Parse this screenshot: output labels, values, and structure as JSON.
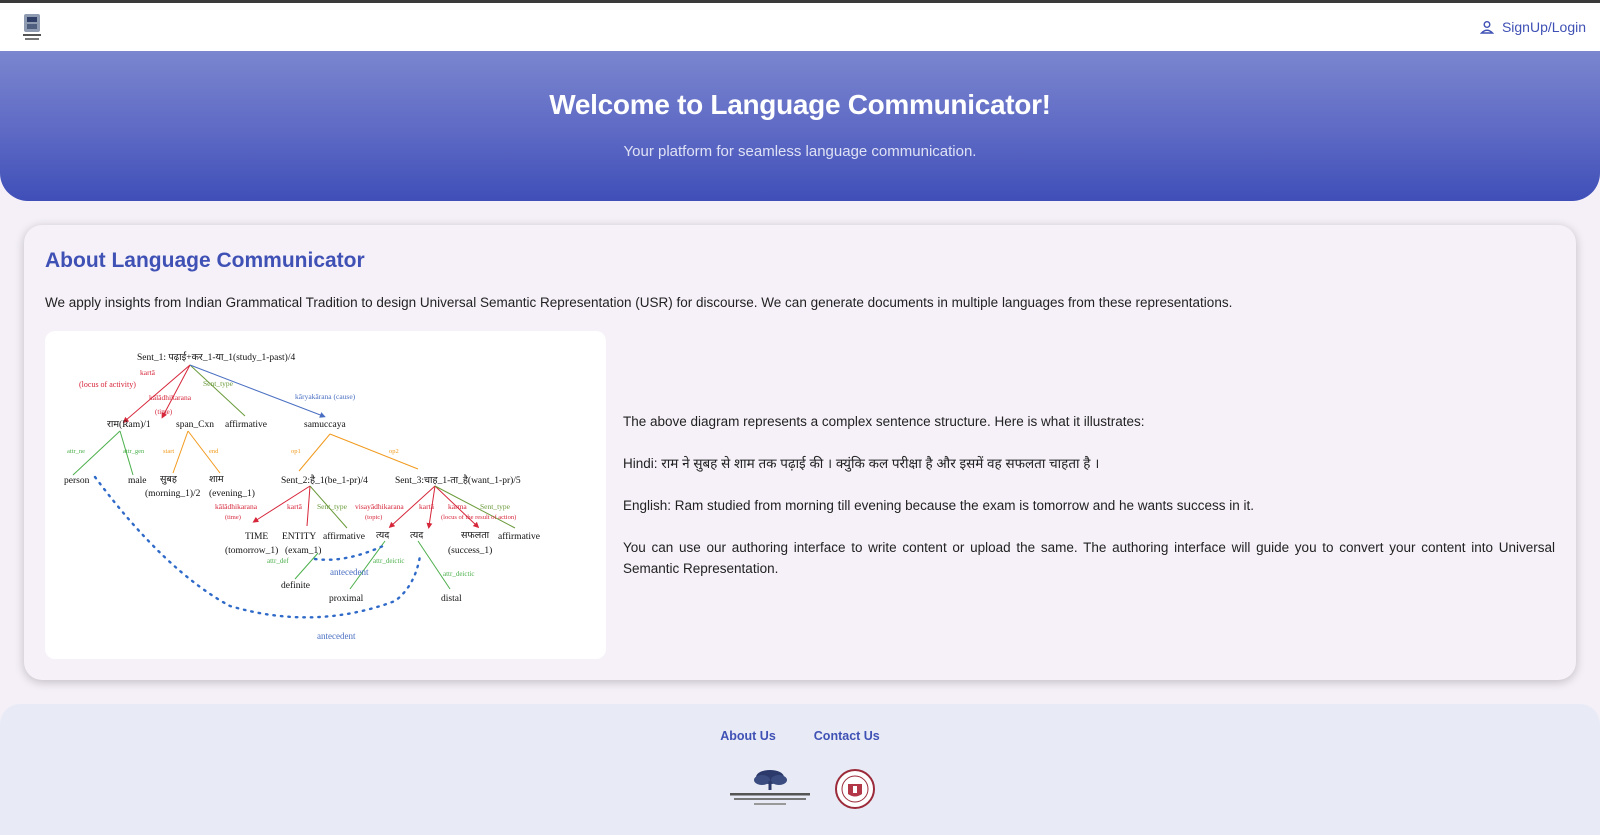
{
  "navbar": {
    "login_label": "SignUp/Login",
    "logo_icon": "institute-crest-icon"
  },
  "hero": {
    "title": "Welcome to Language Communicator!",
    "subtitle": "Your platform for seamless language communication."
  },
  "about": {
    "heading": "About Language Communicator",
    "intro": "We apply insights from Indian Grammatical Tradition to design Universal Semantic Representation (USR) for discourse. We can generate documents in multiple languages from these representations.",
    "diagram": {
      "root": "Sent_1: पढ़ाई+कर_1-या_1(study_1-past)/4",
      "edges": {
        "karta": "kartā",
        "locus": "(locus of activity)",
        "sent_type": "Sent_type",
        "karyakarana": "kāryakārana (cause)",
        "kaladhikarana": "kālādhikarana",
        "time": "(time)",
        "attr_ne": "attr_ne",
        "attr_gen": "attr_gen",
        "start": "start",
        "end": "end",
        "op1": "op1",
        "op2": "op2",
        "kaladhikarana2": "kālādhikarana",
        "time2": "(time)",
        "karta2": "kartā",
        "sent_type2": "Sent_type",
        "visayadhikarana": "visayādhikarana",
        "topic": "(topic)",
        "karta3": "kartā",
        "karma": "karma",
        "locus_result": "(locus of the result of action)",
        "sent_type3": "Sent_type",
        "attr_def": "attr_def",
        "attr_deictic": "attr_deictic",
        "attr_deictic2": "attr_deictic",
        "antecedent": "antecedent",
        "antecedent2": "antecedent"
      },
      "nodes": {
        "ram": "राम(Ram)/1",
        "span": "span_Cxn",
        "affirm1": "affirmative",
        "samuccaya": "samuccaya",
        "person": "person",
        "male": "male",
        "subah": "सुबह",
        "subah_gloss": "(morning_1)/2",
        "shaam": "शाम",
        "shaam_gloss": "(evening_1)",
        "sent2": "Sent_2:है_1(be_1-pr)/4",
        "sent3": "Sent_3:चाह_1-ता_है(want_1-pr)/5",
        "time_node": "TIME",
        "time_gloss": "(tomorrow_1)",
        "entity": "ENTITY",
        "entity_gloss": "(exam_1)",
        "affirm2": "affirmative",
        "tyad1": "त्यद",
        "tyad2": "त्यद",
        "safalta": "सफलता",
        "safalta_gloss": "(success_1)",
        "affirm3": "affirmative",
        "definite": "definite",
        "proximal": "proximal",
        "distal": "distal"
      }
    },
    "description": {
      "line1": "The above diagram represents a complex sentence structure. Here is what it illustrates:",
      "hindi": "Hindi: राम ने सुबह से शाम तक पढ़ाई की । क्युंकि कल परीक्षा है और इसमें वह सफलता चाहता है ।",
      "english": "English: Ram studied from morning till evening because the exam is tomorrow and he wants success in it.",
      "authoring": "You can use our authoring interface to write content or upload the same. The authoring interface will guide you to convert your content into Universal Semantic Representation."
    }
  },
  "footer": {
    "about_link": "About Us",
    "contact_link": "Contact Us",
    "logo1": "IIIT Hyderabad",
    "logo2": "university-seal"
  },
  "colors": {
    "primary": "#3f51b5",
    "hero_top": "#7b86cf",
    "hero_bottom": "#3f4fb8"
  }
}
